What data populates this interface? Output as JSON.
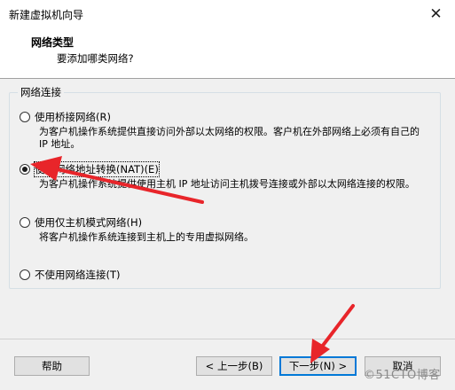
{
  "window": {
    "title": "新建虚拟机向导",
    "close_glyph": "✕"
  },
  "header": {
    "title": "网络类型",
    "subtitle": "要添加哪类网络?"
  },
  "group": {
    "label": "网络连接"
  },
  "options": [
    {
      "label": "使用桥接网络(R)",
      "desc": "为客户机操作系统提供直接访问外部以太网络的权限。客户机在外部网络上必须有自己的 IP 地址。",
      "selected": false
    },
    {
      "label": "使用网络地址转换(NAT)(E)",
      "desc": "为客户机操作系统提供使用主机 IP 地址访问主机拨号连接或外部以太网络连接的权限。",
      "selected": true
    },
    {
      "label": "使用仅主机模式网络(H)",
      "desc": "将客户机操作系统连接到主机上的专用虚拟网络。",
      "selected": false
    },
    {
      "label": "不使用网络连接(T)",
      "desc": "",
      "selected": false
    }
  ],
  "buttons": {
    "help": "帮助",
    "back": "< 上一步(B)",
    "next": "下一步(N) >",
    "cancel": "取消"
  },
  "watermark": "©51CTO博客",
  "colors": {
    "accent": "#0078d7",
    "annotation_arrow": "#e8252a"
  }
}
